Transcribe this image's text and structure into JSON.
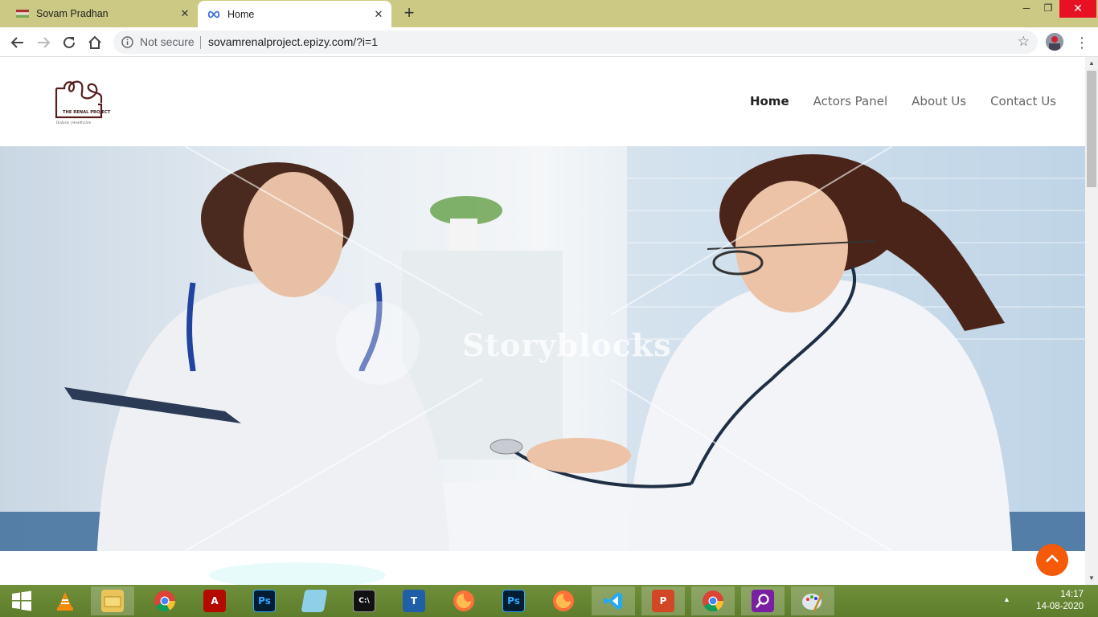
{
  "browser": {
    "tabs": [
      {
        "title": "Sovam Pradhan",
        "active": false,
        "favicon": "flag-favicon-icon"
      },
      {
        "title": "Home",
        "active": true,
        "favicon": "infinity-favicon-icon"
      }
    ],
    "new_tab_icon": "plus-icon",
    "window_controls": [
      "minimize-icon",
      "restore-icon",
      "close-icon"
    ],
    "address_bar": {
      "security_label": "Not secure",
      "url": "sovamrenalproject.epizy.com/?i=1"
    }
  },
  "site": {
    "logo": {
      "text": "THE RENAL PROJECT",
      "tagline": "Dialysis | Healthcare"
    },
    "nav": [
      {
        "label": "Home",
        "current": true
      },
      {
        "label": "Actors Panel",
        "current": false
      },
      {
        "label": "About Us",
        "current": false
      },
      {
        "label": "Contact Us",
        "current": false
      }
    ],
    "hero": {
      "watermark": "Storyblocks"
    },
    "scroll_top_icon": "chevron-up-icon",
    "accent_color": "#f45a07"
  },
  "taskbar": {
    "apps": [
      "windows-start-icon",
      "vlc-icon",
      "file-explorer-icon",
      "chrome-icon",
      "acrobat-icon",
      "photoshop-icon",
      "notepad-icon",
      "cmd-icon",
      "typing-master-icon",
      "firefox-icon",
      "photoshop-icon",
      "firefox-icon",
      "vscode-icon",
      "powerpoint-icon",
      "chrome-icon",
      "search-tool-icon",
      "paint-icon"
    ],
    "clock": {
      "time": "14:17",
      "date": "14-08-2020"
    }
  }
}
